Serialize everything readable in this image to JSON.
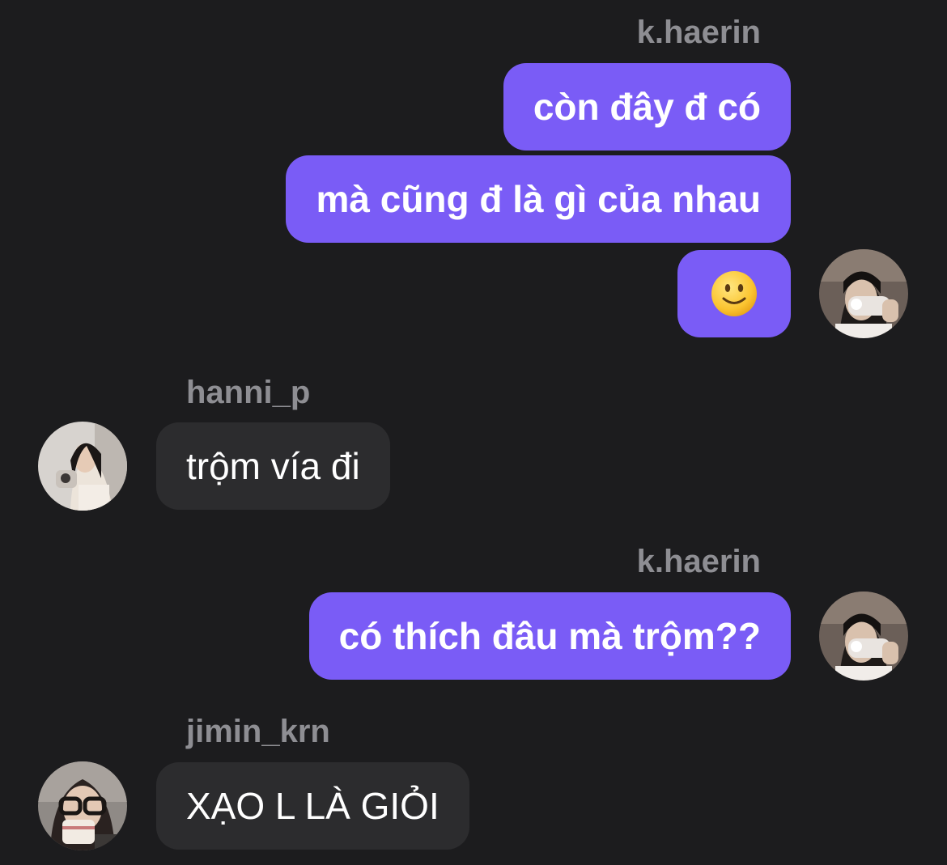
{
  "conversation": {
    "messages": [
      {
        "sender": "k.haerin",
        "direction": "outgoing",
        "text": "còn đây đ có"
      },
      {
        "sender": "k.haerin",
        "direction": "outgoing",
        "text": "mà cũng đ là gì của nhau"
      },
      {
        "sender": "k.haerin",
        "direction": "outgoing",
        "text": "",
        "emoji": "slightly-smiling-face"
      },
      {
        "sender": "hanni_p",
        "direction": "incoming",
        "text": "trộm vía đi"
      },
      {
        "sender": "k.haerin",
        "direction": "outgoing",
        "text": "có thích đâu mà trộm??"
      },
      {
        "sender": "jimin_krn",
        "direction": "incoming",
        "text": "XẠO L LÀ GIỎI"
      }
    ]
  },
  "colors": {
    "background": "#1c1c1e",
    "outgoing_bubble": "#7a5cf6",
    "incoming_bubble": "#2c2c2e",
    "sender_name": "#8e8e93",
    "message_text": "#ffffff"
  },
  "icons": {
    "emoji": "slightly-smiling-face-icon",
    "avatars": [
      "avatar-k-haerin",
      "avatar-hanni-p",
      "avatar-jimin-krn"
    ]
  }
}
